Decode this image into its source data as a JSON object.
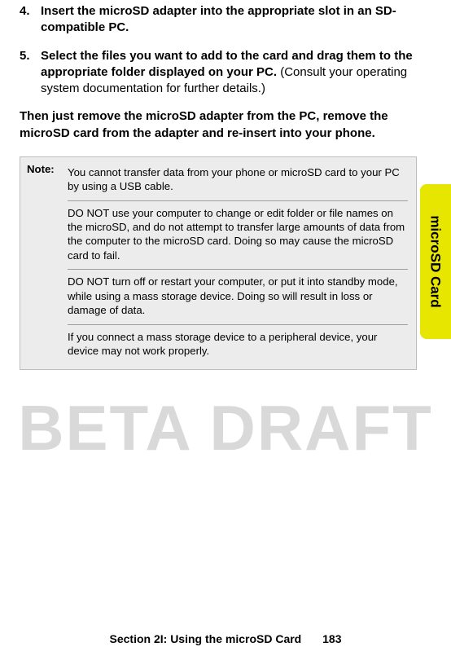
{
  "steps": [
    {
      "num": "4.",
      "bold": "Insert the microSD adapter into the appropriate slot in an SD-compatible PC.",
      "normal": ""
    },
    {
      "num": "5.",
      "bold": "Select the files you want to add to the card and drag them to the appropriate folder displayed on your PC.",
      "normal": " (Consult your operating system documentation for further details.)"
    }
  ],
  "followup": "Then just remove the microSD adapter from the PC, remove the microSD card from the adapter and re-insert into your phone.",
  "note": {
    "label": "Note:",
    "paras": [
      "You cannot transfer data from your phone or microSD card to your PC by using a USB cable.",
      "DO NOT use your computer to change or edit folder or file names on the microSD, and do not attempt to transfer large amounts of data from the computer to the microSD card. Doing so may cause the microSD card to fail.",
      "DO NOT turn off or restart your computer, or put it into standby mode, while using a mass storage device. Doing so will result in loss or damage of data.",
      "If you connect a mass storage device to a peripheral device, your device may not work properly."
    ]
  },
  "sidetab": "microSD Card",
  "watermark": "BETA DRAFT",
  "footer": {
    "section": "Section 2I: Using the microSD Card",
    "page": "183"
  }
}
